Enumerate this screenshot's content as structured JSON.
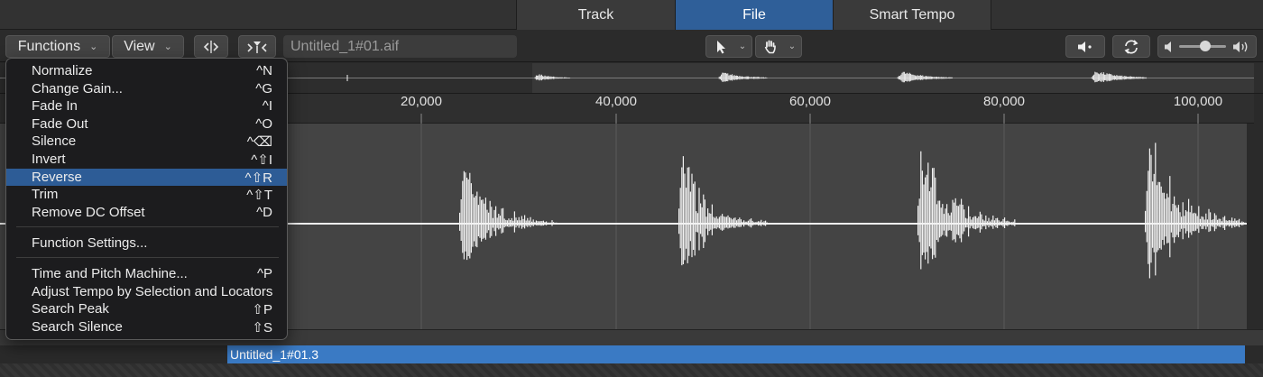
{
  "tabs": [
    {
      "label": "Track",
      "active": false
    },
    {
      "label": "File",
      "active": true
    },
    {
      "label": "Smart Tempo",
      "active": false
    }
  ],
  "toolbar": {
    "functions_label": "Functions",
    "view_label": "View",
    "region_name": "Untitled_1#01.aif",
    "icons": [
      "split-arrows-icon",
      "snap-filter-icon",
      "pointer-tool-icon",
      "hand-tool-icon",
      "speaker-icon",
      "cycle-icon",
      "volume-low-icon",
      "volume-high-icon"
    ],
    "volume_level": 0.55
  },
  "ruler": {
    "labels": [
      "20,000",
      "40,000",
      "60,000",
      "80,000",
      "100,000"
    ]
  },
  "region": {
    "name": "Untitled_1#01.3"
  },
  "menu": {
    "groups": [
      [
        {
          "label": "Normalize",
          "shortcut": "^N"
        },
        {
          "label": "Change Gain...",
          "shortcut": "^G"
        },
        {
          "label": "Fade In",
          "shortcut": "^I"
        },
        {
          "label": "Fade Out",
          "shortcut": "^O"
        },
        {
          "label": "Silence",
          "shortcut": "^⌫"
        },
        {
          "label": "Invert",
          "shortcut": "^⇧I"
        },
        {
          "label": "Reverse",
          "shortcut": "^⇧R",
          "highlighted": true
        },
        {
          "label": "Trim",
          "shortcut": "^⇧T"
        },
        {
          "label": "Remove DC Offset",
          "shortcut": "^D"
        }
      ],
      [
        {
          "label": "Function Settings...",
          "shortcut": ""
        }
      ],
      [
        {
          "label": "Time and Pitch Machine...",
          "shortcut": "^P"
        },
        {
          "label": "Adjust Tempo by Selection and Locators",
          "shortcut": ""
        },
        {
          "label": "Search Peak",
          "shortcut": "⇧P"
        },
        {
          "label": "Search Silence",
          "shortcut": "⇧S"
        }
      ]
    ]
  },
  "colors": {
    "accent": "#2f5f99",
    "menu_highlight": "#2d5c96",
    "region": "#3a7ac4",
    "waveform": "#f2f2f2"
  }
}
